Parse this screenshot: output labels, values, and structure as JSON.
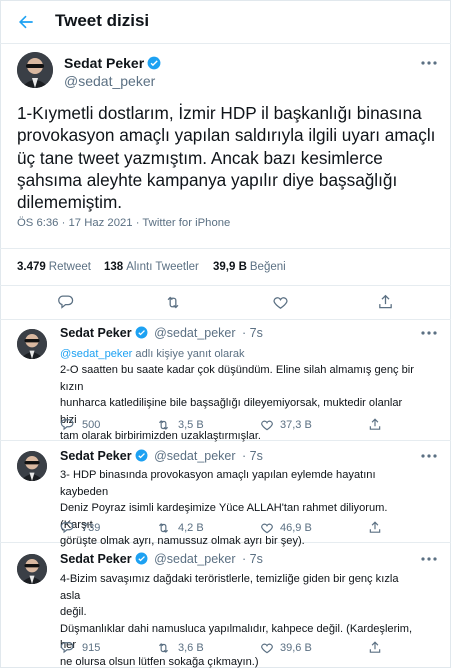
{
  "header": {
    "title": "Tweet dizisi"
  },
  "main_tweet": {
    "author_name": "Sedat Peker",
    "author_handle": "@sedat_peker",
    "text_lines": [
      "1-Kıymetli dostlarım, İzmir HDP il başkanlığı binasına",
      "provokasyon amaçlı yapılan saldırıyla ilgili uyarı amaçlı",
      "üç tane tweet yazmıştım. Ancak bazı kesimlerce",
      "şahsıma aleyhte kampanya yapılır diye başsağlığı",
      "dilememiştim."
    ],
    "meta": "ÖS 6:36 · 17 Haz 2021 · Twitter for iPhone",
    "stats": {
      "retweets_count": "3.479",
      "retweets_label": "Retweet",
      "quotes_count": "138",
      "quotes_label": "Alıntı Tweetler",
      "likes_count": "39,9 B",
      "likes_label": "Beğeni"
    }
  },
  "replies": [
    {
      "author_name": "Sedat Peker",
      "author_handle": "@sedat_peker",
      "time": "· 7s",
      "reply_to_link": "@sedat_peker",
      "reply_to_suffix": " adlı kişiye yanıt olarak",
      "text_lines": [
        "2-O saatten bu saate kadar çok düşündüm. Eline silah almamış genç bir kızın",
        "hunharca katledilişine bile başsağlığı dileyemiyorsak, muktedir olanlar bizi",
        "tam olarak birbirimizden uzaklaştırmışlar."
      ],
      "replies_count": "500",
      "retweets_count": "3,5 B",
      "likes_count": "37,3 B"
    },
    {
      "author_name": "Sedat Peker",
      "author_handle": "@sedat_peker",
      "time": "· 7s",
      "text_lines": [
        "3- HDP binasında provokasyon amaçlı yapılan eylemde hayatını kaybeden",
        "Deniz Poyraz isimli kardeşimize Yüce ALLAH'tan rahmet diliyorum. (Karşıt",
        "görüşte olmak ayrı, namussuz olmak ayrı bir şey)."
      ],
      "replies_count": "739",
      "retweets_count": "4,2 B",
      "likes_count": "46,9 B"
    },
    {
      "author_name": "Sedat Peker",
      "author_handle": "@sedat_peker",
      "time": "· 7s",
      "text_lines": [
        "4-Bizim savaşımız dağdaki teröristlerle, temizliğe giden bir genç kızla asla",
        "değil.",
        "Düşmanlıklar dahi namusluca yapılmalıdır, kahpece değil. (Kardeşlerim, her",
        "ne olursa olsun lütfen sokağa çıkmayın.)"
      ],
      "replies_count": "915",
      "retweets_count": "3,6 B",
      "likes_count": "39,6 B"
    }
  ],
  "colors": {
    "accent": "#1da1f2",
    "muted": "#5b7083",
    "text": "#0f1419",
    "border": "#e6ecf0"
  },
  "icons": [
    "back-arrow-icon",
    "verified-badge-icon",
    "more-options-icon",
    "reply-icon",
    "retweet-icon",
    "like-icon",
    "share-icon"
  ]
}
